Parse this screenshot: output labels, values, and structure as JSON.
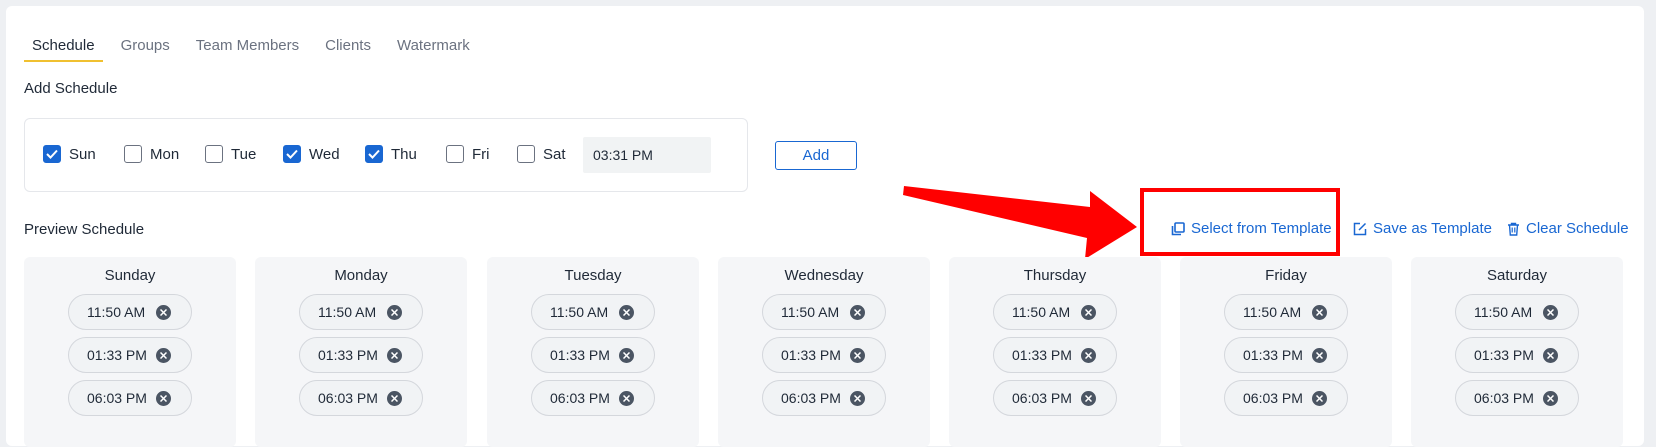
{
  "tabs": [
    {
      "label": "Schedule",
      "active": true
    },
    {
      "label": "Groups",
      "active": false
    },
    {
      "label": "Team Members",
      "active": false
    },
    {
      "label": "Clients",
      "active": false
    },
    {
      "label": "Watermark",
      "active": false
    }
  ],
  "add_schedule": {
    "title": "Add Schedule",
    "days": [
      {
        "label": "Sun",
        "checked": true
      },
      {
        "label": "Mon",
        "checked": false
      },
      {
        "label": "Tue",
        "checked": false
      },
      {
        "label": "Wed",
        "checked": true
      },
      {
        "label": "Thu",
        "checked": true
      },
      {
        "label": "Fri",
        "checked": false
      },
      {
        "label": "Sat",
        "checked": false
      }
    ],
    "time_value": "03:31 PM",
    "add_label": "Add"
  },
  "preview": {
    "title": "Preview Schedule",
    "actions": {
      "select_template": "Select from Template",
      "save_template": "Save as Template",
      "clear_schedule": "Clear Schedule"
    },
    "days": [
      {
        "name": "Sunday",
        "times": [
          "11:50 AM",
          "01:33 PM",
          "06:03 PM"
        ]
      },
      {
        "name": "Monday",
        "times": [
          "11:50 AM",
          "01:33 PM",
          "06:03 PM"
        ]
      },
      {
        "name": "Tuesday",
        "times": [
          "11:50 AM",
          "01:33 PM",
          "06:03 PM"
        ]
      },
      {
        "name": "Wednesday",
        "times": [
          "11:50 AM",
          "01:33 PM",
          "06:03 PM"
        ]
      },
      {
        "name": "Thursday",
        "times": [
          "11:50 AM",
          "01:33 PM",
          "06:03 PM"
        ]
      },
      {
        "name": "Friday",
        "times": [
          "11:50 AM",
          "01:33 PM",
          "06:03 PM"
        ]
      },
      {
        "name": "Saturday",
        "times": [
          "11:50 AM",
          "01:33 PM",
          "06:03 PM"
        ]
      }
    ]
  },
  "colors": {
    "accent": "#1967d2",
    "tab_underline": "#f0c030",
    "annotation": "#ff0000"
  }
}
